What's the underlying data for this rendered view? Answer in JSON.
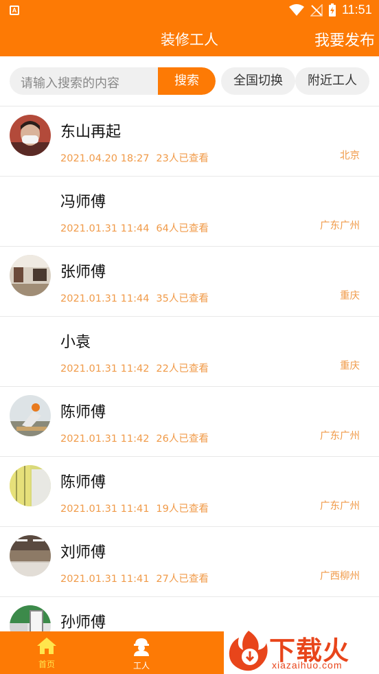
{
  "status": {
    "time": "11:51",
    "app_letter": "A"
  },
  "header": {
    "title": "装修工人",
    "publish_label": "我要发布"
  },
  "search": {
    "placeholder": "请输入搜索的内容",
    "button_label": "搜索",
    "nationwide_label": "全国切换",
    "nearby_label": "附近工人"
  },
  "workers": [
    {
      "name": "东山再起",
      "time": "2021.04.20 18:27",
      "views": "23人已查看",
      "city": "北京",
      "avatar": "photo"
    },
    {
      "name": "冯师傅",
      "time": "2021.01.31 11:44",
      "views": "64人已查看",
      "city": "广东广州",
      "avatar": "none"
    },
    {
      "name": "张师傅",
      "time": "2021.01.31 11:44",
      "views": "35人已查看",
      "city": "重庆",
      "avatar": "photo"
    },
    {
      "name": "小袁",
      "time": "2021.01.31 11:42",
      "views": "22人已查看",
      "city": "重庆",
      "avatar": "none"
    },
    {
      "name": "陈师傅",
      "time": "2021.01.31 11:42",
      "views": "26人已查看",
      "city": "广东广州",
      "avatar": "photo"
    },
    {
      "name": "陈师傅",
      "time": "2021.01.31 11:41",
      "views": "19人已查看",
      "city": "广东广州",
      "avatar": "photo"
    },
    {
      "name": "刘师傅",
      "time": "2021.01.31 11:41",
      "views": "27人已查看",
      "city": "广西柳州",
      "avatar": "photo"
    },
    {
      "name": "孙师傅",
      "time": "",
      "views": "",
      "city": "",
      "avatar": "photo"
    }
  ],
  "tabbar": {
    "home_label": "首页",
    "worker_label": "工人",
    "active": "home",
    "icons": [
      "home-icon",
      "worker-icon"
    ]
  },
  "watermark": {
    "title": "下载火",
    "subtitle": "xiazaihuo.com"
  },
  "colors": {
    "brand": "#fd7a05",
    "meta": "#f09a48",
    "active_tab": "#ffe64d",
    "watermark": "#e8451b"
  }
}
